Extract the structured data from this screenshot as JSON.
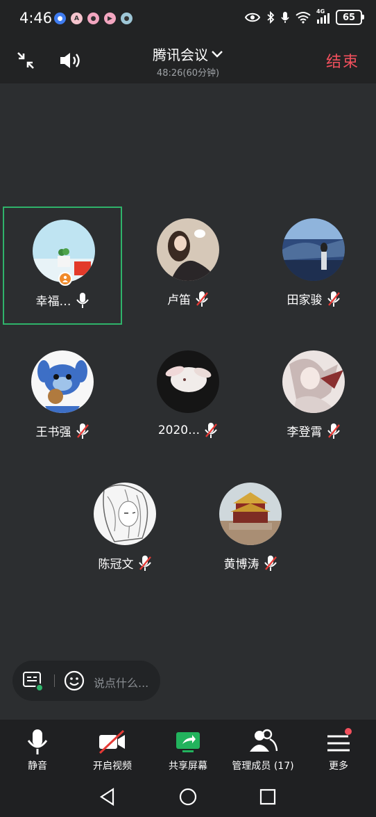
{
  "status_bar": {
    "time": "4:46",
    "battery": "65",
    "network": "4G"
  },
  "header": {
    "title": "腾讯会议",
    "duration": "48:26(60分钟)",
    "end_label": "结束"
  },
  "participants": [
    {
      "name": "幸福…",
      "muted": false,
      "host": true
    },
    {
      "name": "卢笛",
      "muted": true
    },
    {
      "name": "田家骏",
      "muted": true
    },
    {
      "name": "王书强",
      "muted": true
    },
    {
      "name": "2020…",
      "muted": true
    },
    {
      "name": "李登霄",
      "muted": true
    },
    {
      "name": "陈冠文",
      "muted": true
    },
    {
      "name": "黄博涛",
      "muted": true
    }
  ],
  "chat": {
    "placeholder": "说点什么..."
  },
  "toolbar": {
    "mute": "静音",
    "video": "开启视频",
    "share": "共享屏幕",
    "members": "管理成员 (17)",
    "more": "更多"
  },
  "colors": {
    "accent_end": "#f2505d",
    "active_border": "#2fb36a",
    "share_green": "#22b35d",
    "notify_dot": "#f2505d"
  }
}
